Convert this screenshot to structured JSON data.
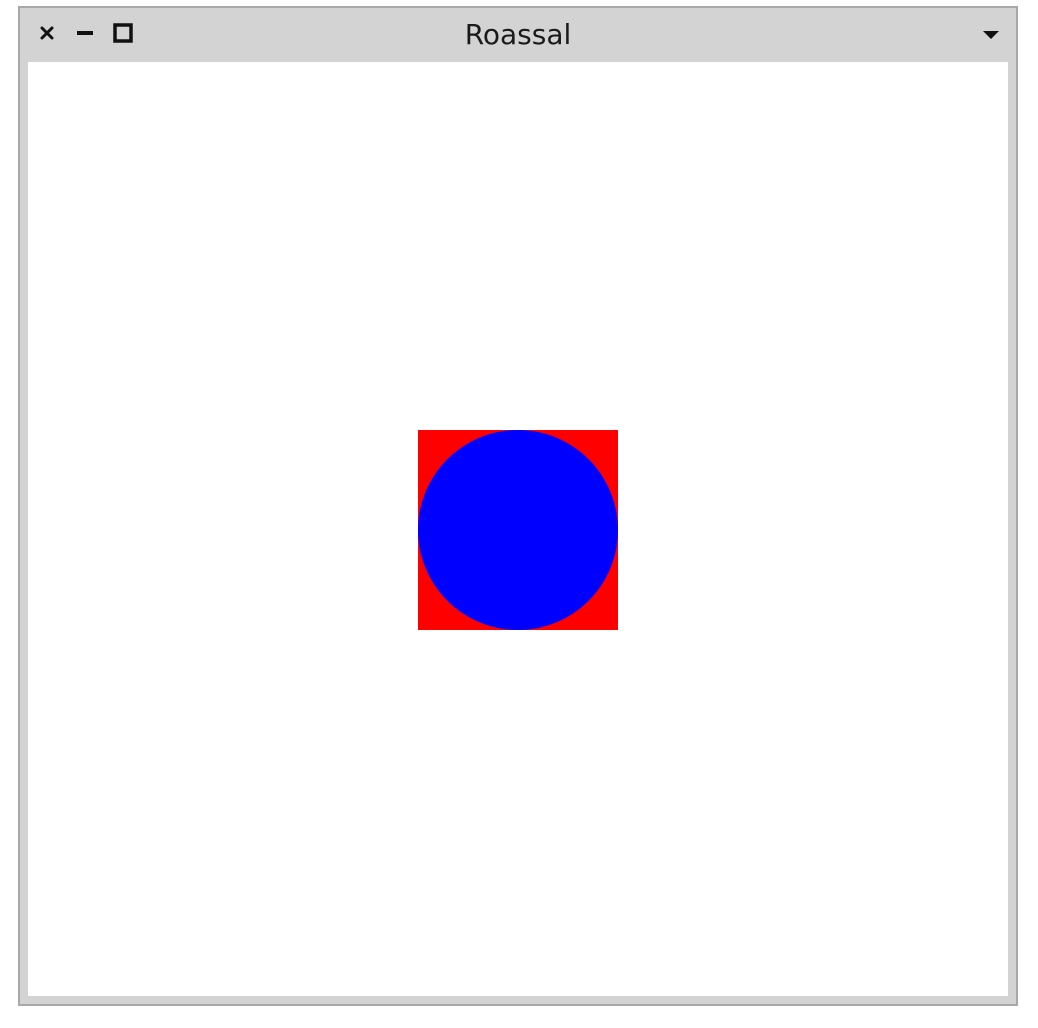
{
  "window": {
    "title": "Roassal",
    "buttons": {
      "close": "close-icon",
      "minimize": "minimize-icon",
      "maximize": "maximize-icon",
      "menu": "dropdown-arrow-icon"
    }
  },
  "canvas": {
    "background": "#ffffff",
    "shapes": [
      {
        "type": "box",
        "color": "#ff0000"
      },
      {
        "type": "circle",
        "color": "#0000ff"
      }
    ]
  }
}
